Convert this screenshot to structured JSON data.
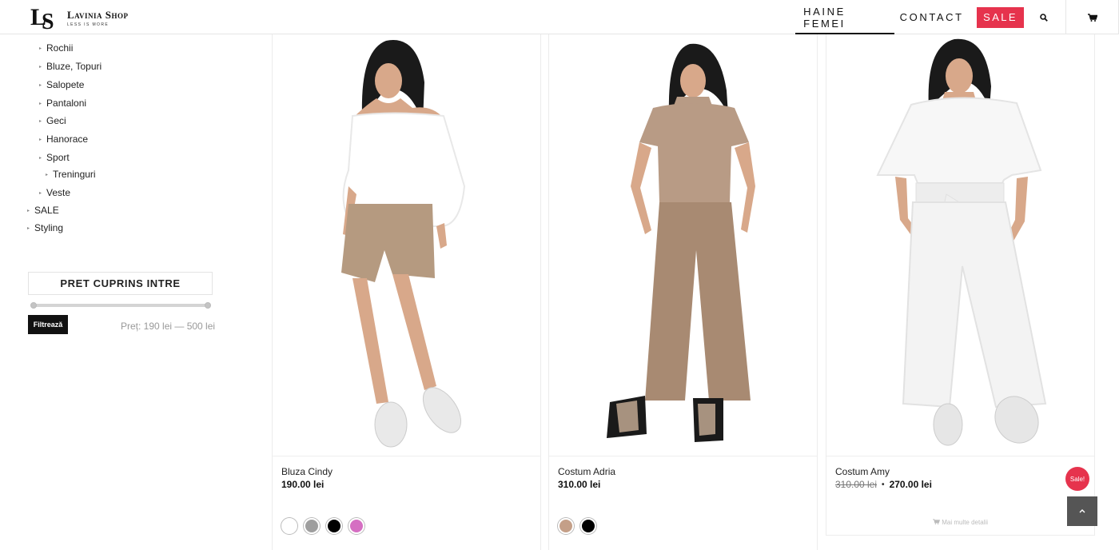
{
  "brand": {
    "name": "Lavinia Shop",
    "tagline": "LESS IS MORE",
    "mark": "LS"
  },
  "nav": {
    "women": "HAINE FEMEI",
    "contact": "CONTACT",
    "sale": "SALE",
    "search_icon": "search-icon",
    "cart_icon": "cart-icon"
  },
  "sidebar": {
    "categories": [
      {
        "label": "Rochii",
        "level": 2
      },
      {
        "label": "Bluze, Topuri",
        "level": 2
      },
      {
        "label": "Salopete",
        "level": 2
      },
      {
        "label": "Pantaloni",
        "level": 2
      },
      {
        "label": "Geci",
        "level": 2
      },
      {
        "label": "Hanorace",
        "level": 2
      },
      {
        "label": "Sport",
        "level": 2
      },
      {
        "label": "Treninguri",
        "level": 3
      },
      {
        "label": "Veste",
        "level": 2
      },
      {
        "label": "SALE",
        "level": 1
      },
      {
        "label": "Styling",
        "level": 1
      }
    ],
    "price_filter": {
      "title": "PRET CUPRINS INTRE",
      "button": "Filtrează",
      "range_label": "Preț: 190 lei — 500 lei",
      "min": 190,
      "max": 500
    }
  },
  "products": [
    {
      "name": "Bluza Cindy",
      "price": "190.00 lei",
      "swatches": [
        "#ffffff",
        "#9e9e9e",
        "#000000",
        "#d56fc2"
      ],
      "top_color": "#ffffff",
      "bottom_color": "#b59a80"
    },
    {
      "name": "Costum Adria",
      "price": "310.00 lei",
      "swatches": [
        "#c49f88",
        "#000000"
      ],
      "top_color": "#b89b85",
      "bottom_color": "#a88a72"
    },
    {
      "name": "Costum Amy",
      "old_price": "310.00 lei",
      "dot": "•",
      "price": "270.00 lei",
      "badge": "Sale!",
      "more": "Mai multe detalii",
      "top_color": "#f7f7f7",
      "bottom_color": "#f2f2f2"
    }
  ],
  "scroll_top_icon": "chevron-up-icon"
}
